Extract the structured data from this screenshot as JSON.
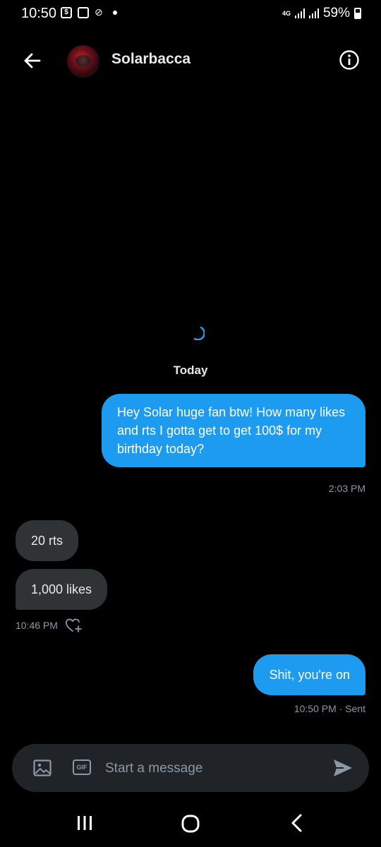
{
  "status": {
    "time": "10:50",
    "network": "4G",
    "battery": "59%",
    "icons": [
      "shop-icon",
      "gallery-icon",
      "mute-icon",
      "dot-icon"
    ]
  },
  "header": {
    "contact_name": "Solarbacca",
    "icons": [
      "back-arrow-icon",
      "info-icon"
    ]
  },
  "conversation": {
    "date_separator": "Today",
    "messages": [
      {
        "direction": "sent",
        "text": "Hey Solar huge fan btw! How many likes and rts I gotta get to get 100$ for my birthday today?",
        "time": "2:03 PM"
      },
      {
        "direction": "received",
        "text": "20 rts"
      },
      {
        "direction": "received",
        "text": "1,000 likes",
        "time": "10:46 PM"
      },
      {
        "direction": "sent",
        "text": "Shit, you're on",
        "time": "10:50 PM · Sent"
      }
    ]
  },
  "composer": {
    "placeholder": "Start a message",
    "gif_label": "GIF",
    "icons": [
      "image-icon",
      "gif-icon",
      "send-icon"
    ]
  },
  "nav": {
    "icons": [
      "recents-icon",
      "home-icon",
      "back-icon"
    ]
  },
  "colors": {
    "background": "#000000",
    "sent_bubble": "#1d9bf0",
    "received_bubble": "#2f3336",
    "muted_text": "#8b98a5"
  }
}
